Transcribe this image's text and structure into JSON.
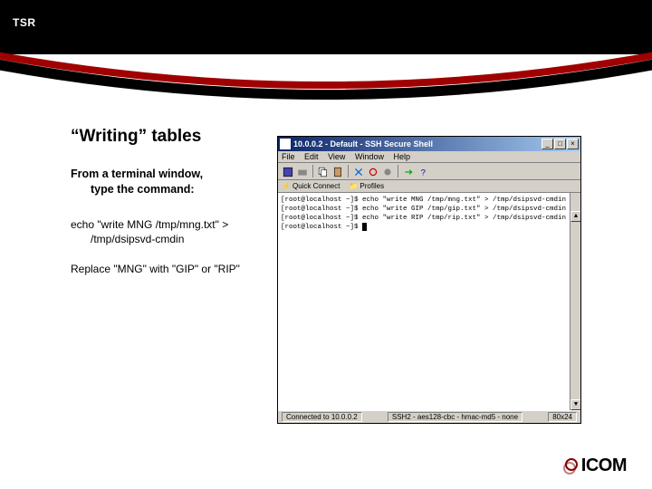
{
  "header": {
    "tsr": "TSR"
  },
  "slide": {
    "title": "“Writing” tables",
    "body1": "From a terminal window,",
    "body1_sub": "type the command:",
    "cmd1": "echo \"write MNG /tmp/mng.txt\" >",
    "cmd1_sub": "/tmp/dsipsvd-cmdin",
    "note": "Replace \"MNG\" with \"GIP\" or \"RIP\""
  },
  "terminal": {
    "title": "10.0.0.2 - Default - SSH Secure Shell",
    "menu": [
      "File",
      "Edit",
      "View",
      "Window",
      "Help"
    ],
    "quickbar": [
      {
        "icon": "lightning-icon",
        "label": "Quick Connect"
      },
      {
        "icon": "folder-icon",
        "label": "Profiles"
      }
    ],
    "lines": [
      "[root@localhost ~]$ echo \"write MNG /tmp/mng.txt\" > /tmp/dsipsvd-cmdin",
      "[root@localhost ~]$ echo \"write GIP /tmp/gip.txt\" > /tmp/dsipsvd-cmdin",
      "[root@localhost ~]$ echo \"write RIP /tmp/rip.txt\" > /tmp/dsipsvd-cmdin",
      "[root@localhost ~]$ "
    ],
    "status_left": "Connected to 10.0.0.2",
    "status_mid": "SSH2 - aes128-cbc - hmac-md5 - none",
    "status_right": "80x24"
  },
  "logo": {
    "text": "ICOM"
  },
  "win_buttons": {
    "min": "_",
    "max": "□",
    "close": "×"
  },
  "scroll": {
    "up": "▲",
    "down": "▼"
  }
}
